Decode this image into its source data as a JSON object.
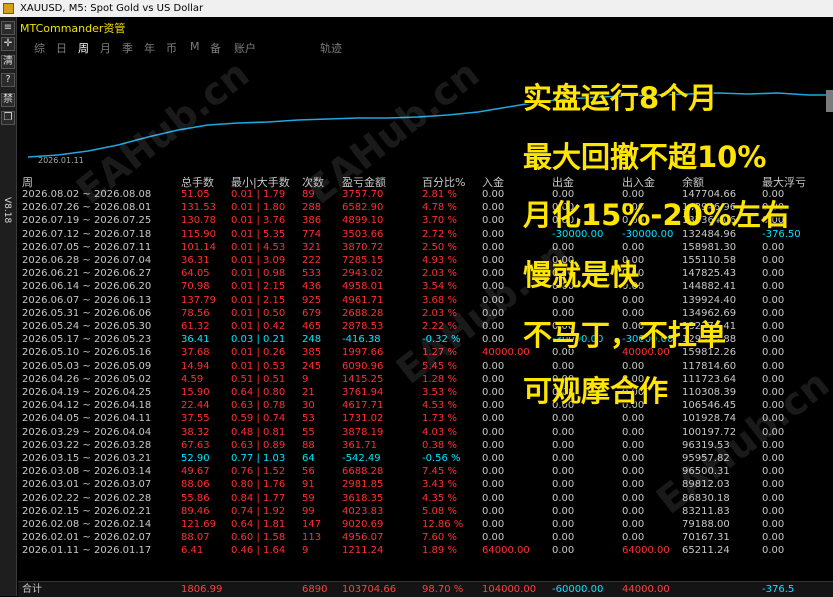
{
  "window": {
    "title": "XAUUSD, M5:  Spot Gold vs US Dollar"
  },
  "app": {
    "title": "MTCommander资管",
    "version": "V8.18"
  },
  "sidebar": {
    "buttons": [
      "≡",
      "✛",
      "清",
      "?",
      "禁",
      "❐"
    ]
  },
  "tabs": [
    {
      "label": "综",
      "active": false
    },
    {
      "label": "日",
      "active": false
    },
    {
      "label": "周",
      "active": true
    },
    {
      "label": "月",
      "active": false
    },
    {
      "label": "季",
      "active": false
    },
    {
      "label": "年",
      "active": false
    },
    {
      "label": "币",
      "active": false
    },
    {
      "label": "M",
      "active": false
    },
    {
      "label": "备",
      "active": false
    },
    {
      "label": "账户",
      "active": false
    },
    {
      "label": "轨迹",
      "active": false
    }
  ],
  "equity_chart": {
    "start_label": "2026.01.11",
    "line_color": "#1fa8e0"
  },
  "columns": [
    "周",
    "总手数",
    "最小|大手数",
    "次数",
    "盈亏金额",
    "百分比%",
    "入金",
    "出金",
    "出入金",
    "余额",
    "最大浮亏"
  ],
  "rows": [
    {
      "week": "2026.08.02 ~ 2026.08.08",
      "lots": "51.05",
      "minmax": "0.01 | 1.79",
      "count": "89",
      "pnl": "3757.70",
      "pct": "2.81 %",
      "dep": "0.00",
      "wd": "0.00",
      "net": "0.00",
      "bal": "147704.66",
      "dd": "0.00",
      "color": "red"
    },
    {
      "week": "2026.07.26 ~ 2026.08.01",
      "lots": "131.53",
      "minmax": "0.01 | 1.80",
      "count": "288",
      "pnl": "6582.90",
      "pct": "4.78 %",
      "dep": "0.00",
      "wd": "0.00",
      "net": "0.00",
      "bal": "143946.96",
      "dd": "0.00",
      "color": "red"
    },
    {
      "week": "2026.07.19 ~ 2026.07.25",
      "lots": "130.78",
      "minmax": "0.01 | 3.76",
      "count": "386",
      "pnl": "4899.10",
      "pct": "3.70 %",
      "dep": "0.00",
      "wd": "0.00",
      "net": "0.00",
      "bal": "137364.06",
      "dd": "0.00",
      "color": "red"
    },
    {
      "week": "2026.07.12 ~ 2026.07.18",
      "lots": "115.90",
      "minmax": "0.01 | 5.35",
      "count": "774",
      "pnl": "3503.66",
      "pct": "2.72 %",
      "dep": "0.00",
      "wd": "-30000.00",
      "net": "-30000.00",
      "bal": "132484.96",
      "dd": "-376.50",
      "color": "red"
    },
    {
      "week": "2026.07.05 ~ 2026.07.11",
      "lots": "101.14",
      "minmax": "0.01 | 4.53",
      "count": "321",
      "pnl": "3870.72",
      "pct": "2.50 %",
      "dep": "0.00",
      "wd": "0.00",
      "net": "0.00",
      "bal": "158981.30",
      "dd": "0.00",
      "color": "red"
    },
    {
      "week": "2026.06.28 ~ 2026.07.04",
      "lots": "36.31",
      "minmax": "0.01 | 3.09",
      "count": "222",
      "pnl": "7285.15",
      "pct": "4.93 %",
      "dep": "0.00",
      "wd": "0.00",
      "net": "0.00",
      "bal": "155110.58",
      "dd": "0.00",
      "color": "red"
    },
    {
      "week": "2026.06.21 ~ 2026.06.27",
      "lots": "64.05",
      "minmax": "0.01 | 0.98",
      "count": "533",
      "pnl": "2943.02",
      "pct": "2.03 %",
      "dep": "0.00",
      "wd": "0.00",
      "net": "0.00",
      "bal": "147825.43",
      "dd": "0.00",
      "color": "red"
    },
    {
      "week": "2026.06.14 ~ 2026.06.20",
      "lots": "70.98",
      "minmax": "0.01 | 2.15",
      "count": "436",
      "pnl": "4958.01",
      "pct": "3.54 %",
      "dep": "0.00",
      "wd": "0.00",
      "net": "0.00",
      "bal": "144882.41",
      "dd": "0.00",
      "color": "red"
    },
    {
      "week": "2026.06.07 ~ 2026.06.13",
      "lots": "137.79",
      "minmax": "0.01 | 2.15",
      "count": "925",
      "pnl": "4961.71",
      "pct": "3.68 %",
      "dep": "0.00",
      "wd": "0.00",
      "net": "0.00",
      "bal": "139924.40",
      "dd": "0.00",
      "color": "red"
    },
    {
      "week": "2026.05.31 ~ 2026.06.06",
      "lots": "78.56",
      "minmax": "0.01 | 0.50",
      "count": "679",
      "pnl": "2688.28",
      "pct": "2.03 %",
      "dep": "0.00",
      "wd": "0.00",
      "net": "0.00",
      "bal": "134962.69",
      "dd": "0.00",
      "color": "red"
    },
    {
      "week": "2026.05.24 ~ 2026.05.30",
      "lots": "61.32",
      "minmax": "0.01 | 0.42",
      "count": "465",
      "pnl": "2878.53",
      "pct": "2.22 %",
      "dep": "0.00",
      "wd": "0.00",
      "net": "0.00",
      "bal": "132274.41",
      "dd": "0.00",
      "color": "red"
    },
    {
      "week": "2026.05.17 ~ 2026.05.23",
      "lots": "36.41",
      "minmax": "0.03 | 0.21",
      "count": "248",
      "pnl": "-416.38",
      "pct": "-0.32 %",
      "dep": "0.00",
      "wd": "-30000.00",
      "net": "-30000.00",
      "bal": "129395.88",
      "dd": "0.00",
      "color": "cyan"
    },
    {
      "week": "2026.05.10 ~ 2026.05.16",
      "lots": "37.68",
      "minmax": "0.01 | 0.26",
      "count": "385",
      "pnl": "1997.66",
      "pct": "1.27 %",
      "dep": "40000.00",
      "wd": "0.00",
      "net": "40000.00",
      "bal": "159812.26",
      "dd": "0.00",
      "color": "red"
    },
    {
      "week": "2026.05.03 ~ 2026.05.09",
      "lots": "14.94",
      "minmax": "0.01 | 0.53",
      "count": "245",
      "pnl": "6090.96",
      "pct": "5.45 %",
      "dep": "0.00",
      "wd": "0.00",
      "net": "0.00",
      "bal": "117814.60",
      "dd": "0.00",
      "color": "red"
    },
    {
      "week": "2026.04.26 ~ 2026.05.02",
      "lots": "4.59",
      "minmax": "0.51 | 0.51",
      "count": "9",
      "pnl": "1415.25",
      "pct": "1.28 %",
      "dep": "0.00",
      "wd": "0.00",
      "net": "0.00",
      "bal": "111723.64",
      "dd": "0.00",
      "color": "red"
    },
    {
      "week": "2026.04.19 ~ 2026.04.25",
      "lots": "15.90",
      "minmax": "0.64 | 0.80",
      "count": "21",
      "pnl": "3761.94",
      "pct": "3.53 %",
      "dep": "0.00",
      "wd": "0.00",
      "net": "0.00",
      "bal": "110308.39",
      "dd": "0.00",
      "color": "red"
    },
    {
      "week": "2026.04.12 ~ 2026.04.18",
      "lots": "22.44",
      "minmax": "0.63 | 0.78",
      "count": "30",
      "pnl": "4617.71",
      "pct": "4.53 %",
      "dep": "0.00",
      "wd": "0.00",
      "net": "0.00",
      "bal": "106546.45",
      "dd": "0.00",
      "color": "red"
    },
    {
      "week": "2026.04.05 ~ 2026.04.11",
      "lots": "37.55",
      "minmax": "0.59 | 0.74",
      "count": "53",
      "pnl": "1731.02",
      "pct": "1.73 %",
      "dep": "0.00",
      "wd": "0.00",
      "net": "0.00",
      "bal": "101928.74",
      "dd": "0.00",
      "color": "red"
    },
    {
      "week": "2026.03.29 ~ 2026.04.04",
      "lots": "38.32",
      "minmax": "0.48 | 0.81",
      "count": "55",
      "pnl": "3878.19",
      "pct": "4.03 %",
      "dep": "0.00",
      "wd": "0.00",
      "net": "0.00",
      "bal": "100197.72",
      "dd": "0.00",
      "color": "red"
    },
    {
      "week": "2026.03.22 ~ 2026.03.28",
      "lots": "67.63",
      "minmax": "0.63 | 0.89",
      "count": "88",
      "pnl": "361.71",
      "pct": "0.38 %",
      "dep": "0.00",
      "wd": "0.00",
      "net": "0.00",
      "bal": "96319.53",
      "dd": "0.00",
      "color": "red"
    },
    {
      "week": "2026.03.15 ~ 2026.03.21",
      "lots": "52.90",
      "minmax": "0.77 | 1.03",
      "count": "64",
      "pnl": "-542.49",
      "pct": "-0.56 %",
      "dep": "0.00",
      "wd": "0.00",
      "net": "0.00",
      "bal": "95957.82",
      "dd": "0.00",
      "color": "cyan"
    },
    {
      "week": "2026.03.08 ~ 2026.03.14",
      "lots": "49.67",
      "minmax": "0.76 | 1.52",
      "count": "56",
      "pnl": "6688.28",
      "pct": "7.45 %",
      "dep": "0.00",
      "wd": "0.00",
      "net": "0.00",
      "bal": "96500.31",
      "dd": "0.00",
      "color": "red"
    },
    {
      "week": "2026.03.01 ~ 2026.03.07",
      "lots": "88.06",
      "minmax": "0.80 | 1.76",
      "count": "91",
      "pnl": "2981.85",
      "pct": "3.43 %",
      "dep": "0.00",
      "wd": "0.00",
      "net": "0.00",
      "bal": "89812.03",
      "dd": "0.00",
      "color": "red"
    },
    {
      "week": "2026.02.22 ~ 2026.02.28",
      "lots": "55.86",
      "minmax": "0.84 | 1.77",
      "count": "59",
      "pnl": "3618.35",
      "pct": "4.35 %",
      "dep": "0.00",
      "wd": "0.00",
      "net": "0.00",
      "bal": "86830.18",
      "dd": "0.00",
      "color": "red"
    },
    {
      "week": "2026.02.15 ~ 2026.02.21",
      "lots": "89.46",
      "minmax": "0.74 | 1.92",
      "count": "99",
      "pnl": "4023.83",
      "pct": "5.08 %",
      "dep": "0.00",
      "wd": "0.00",
      "net": "0.00",
      "bal": "83211.83",
      "dd": "0.00",
      "color": "red"
    },
    {
      "week": "2026.02.08 ~ 2026.02.14",
      "lots": "121.69",
      "minmax": "0.64 | 1.81",
      "count": "147",
      "pnl": "9020.69",
      "pct": "12.86 %",
      "dep": "0.00",
      "wd": "0.00",
      "net": "0.00",
      "bal": "79188.00",
      "dd": "0.00",
      "color": "red"
    },
    {
      "week": "2026.02.01 ~ 2026.02.07",
      "lots": "88.07",
      "minmax": "0.60 | 1.58",
      "count": "113",
      "pnl": "4956.07",
      "pct": "7.60 %",
      "dep": "0.00",
      "wd": "0.00",
      "net": "0.00",
      "bal": "70167.31",
      "dd": "0.00",
      "color": "red"
    },
    {
      "week": "2026.01.11 ~ 2026.01.17",
      "lots": "6.41",
      "minmax": "0.46 | 1.64",
      "count": "9",
      "pnl": "1211.24",
      "pct": "1.89 %",
      "dep": "64000.00",
      "wd": "0.00",
      "net": "64000.00",
      "bal": "65211.24",
      "dd": "0.00",
      "color": "red"
    }
  ],
  "totals": {
    "label": "合计",
    "lots": "1806.99",
    "count": "6890",
    "pnl": "103704.66",
    "pct": "98.70 %",
    "dep": "104000.00",
    "wd": "-60000.00",
    "net": "44000.00",
    "dd": "-376.5"
  },
  "overlay_text": [
    "实盘运行8个月",
    "最大回撤不超10%",
    "月化15%-20%左右",
    "慢就是快",
    "不马丁，不扛单",
    "可观摩合作"
  ],
  "watermark": "EAHub.cn",
  "colors": {
    "red": "#ff3030",
    "cyan": "#00e5ff",
    "yellow": "#ffe500",
    "gray": "#c8c8c8",
    "total_red": "#ff4040"
  }
}
